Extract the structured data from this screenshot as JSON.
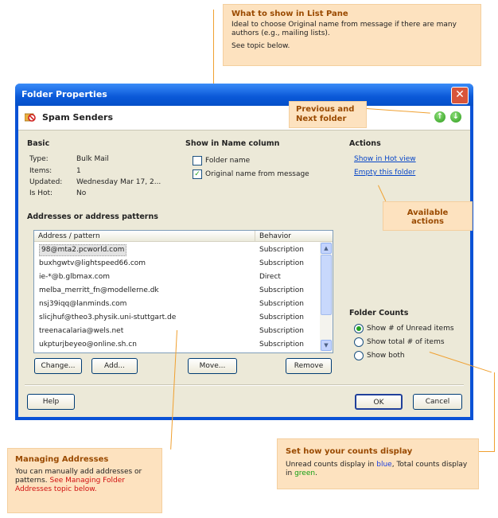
{
  "callouts": {
    "list_pane": {
      "title": "What to show in List Pane",
      "body": "Ideal to choose Original name from message if there are many authors (e.g., mailing lists).",
      "note": "See topic below."
    },
    "nav": {
      "title": "Previous and Next folder"
    },
    "actions": {
      "title": "Available actions"
    },
    "counts": {
      "title": "Set how your counts display",
      "body_prefix": "Unread counts display in ",
      "blue_word": "blue",
      "body_mid": ", Total counts display in ",
      "green_word": "green",
      "body_suffix": "."
    },
    "managing": {
      "title": "Managing Addresses",
      "body": "You can manually add addresses or patterns.",
      "link": "See Managing Folder Addresses topic below."
    }
  },
  "dialog": {
    "title": "Folder Properties",
    "close": "✕",
    "folder_name": "Spam Senders",
    "nav_prev": "↑",
    "nav_next": "↓"
  },
  "basic": {
    "heading": "Basic",
    "rows": [
      {
        "label": "Type:",
        "value": "Bulk Mail"
      },
      {
        "label": "Items:",
        "value": "1"
      },
      {
        "label": "Updated:",
        "value": "Wednesday Mar 17, 2..."
      },
      {
        "label": "Is Hot:",
        "value": "No"
      }
    ]
  },
  "name_column": {
    "heading": "Show in Name column",
    "options": [
      {
        "label": "Folder name",
        "checked": false
      },
      {
        "label": "Original name from message",
        "checked": true
      }
    ]
  },
  "actions": {
    "heading": "Actions",
    "links": [
      "Show in Hot view",
      "Empty this folder"
    ]
  },
  "addresses": {
    "heading": "Addresses or address patterns",
    "columns": [
      "Address / pattern",
      "Behavior"
    ],
    "rows": [
      {
        "address": "98@mta2.pcworld.com",
        "behavior": "Subscription"
      },
      {
        "address": "buxhgwtv@lightspeed66.com",
        "behavior": "Subscription"
      },
      {
        "address": "ie-*@b.glbmax.com",
        "behavior": "Direct"
      },
      {
        "address": "melba_merritt_fn@modellerne.dk",
        "behavior": "Subscription"
      },
      {
        "address": "nsj39iqq@lanminds.com",
        "behavior": "Subscription"
      },
      {
        "address": "slicjhuf@theo3.physik.uni-stuttgart.de",
        "behavior": "Subscription"
      },
      {
        "address": "treenacalaria@wels.net",
        "behavior": "Subscription"
      },
      {
        "address": "ukpturjbeyeo@online.sh.cn",
        "behavior": "Subscription"
      }
    ],
    "buttons": {
      "change": "Change...",
      "add": "Add...",
      "move": "Move...",
      "remove": "Remove"
    }
  },
  "counts": {
    "heading": "Folder Counts",
    "options": [
      {
        "label": "Show # of Unread items",
        "selected": true
      },
      {
        "label": "Show total # of items",
        "selected": false
      },
      {
        "label": "Show both",
        "selected": false
      }
    ]
  },
  "footer": {
    "help": "Help",
    "ok": "OK",
    "cancel": "Cancel"
  }
}
